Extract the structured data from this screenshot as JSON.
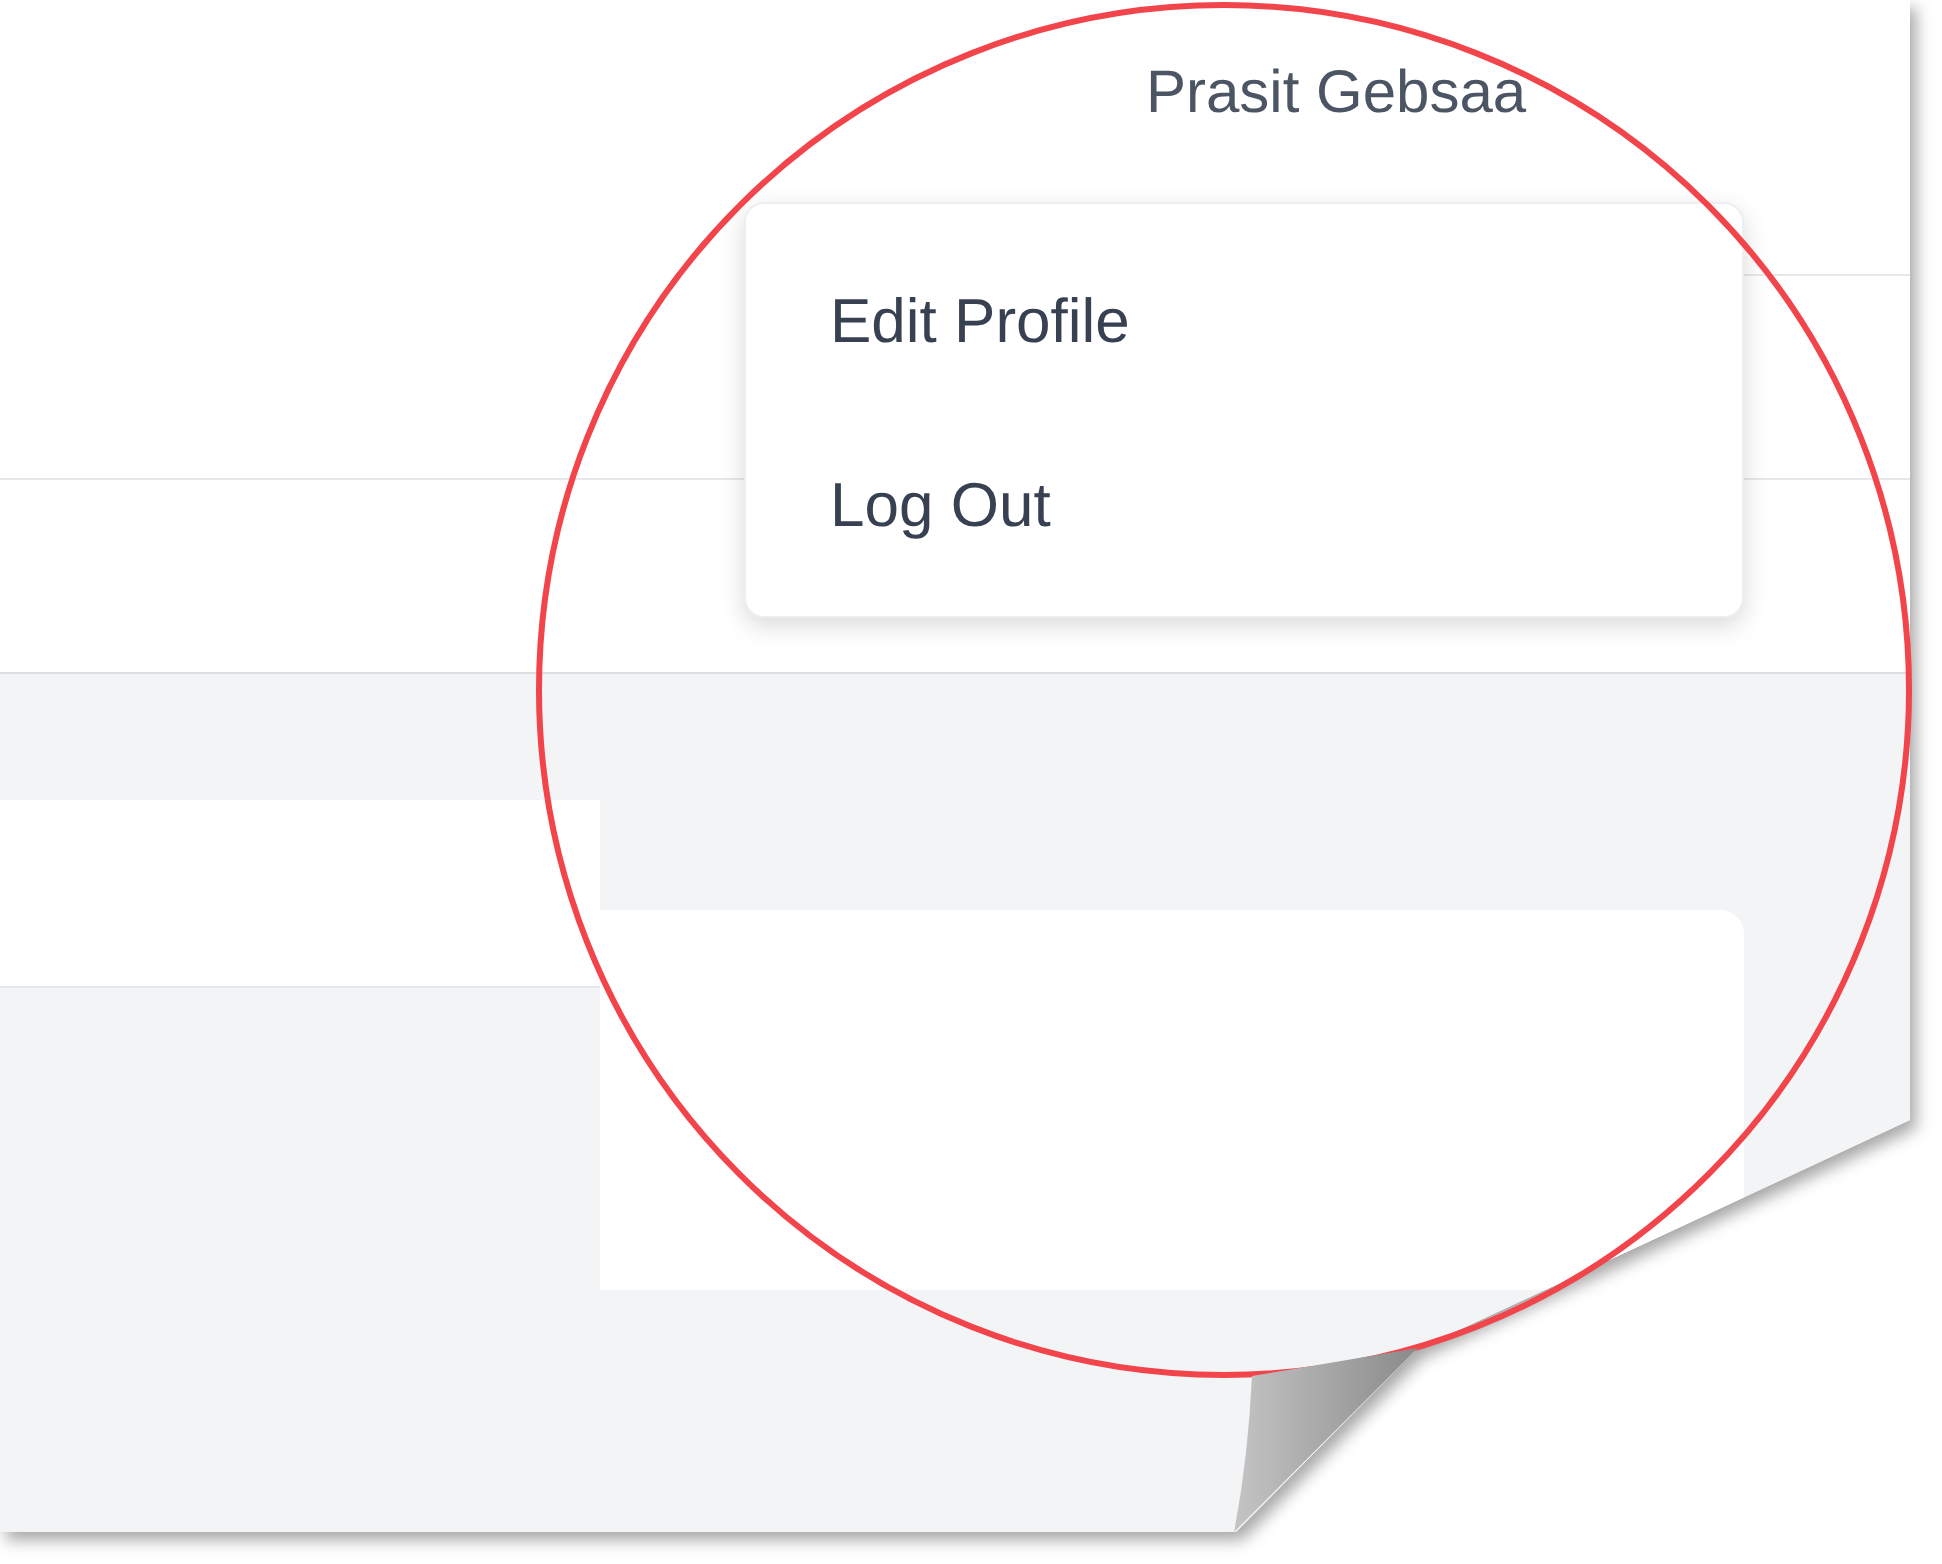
{
  "header": {
    "user_name": "Prasit Gebsaa"
  },
  "dropdown": {
    "items": [
      {
        "label": "Edit Profile"
      },
      {
        "label": "Log Out"
      }
    ]
  }
}
